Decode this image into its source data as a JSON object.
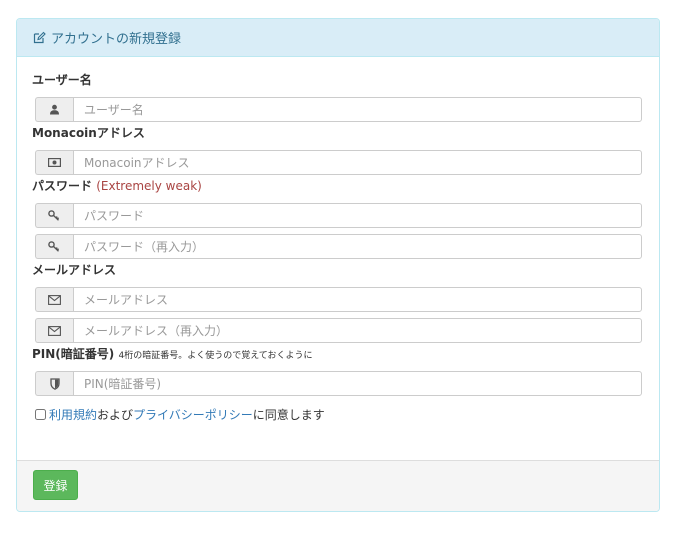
{
  "panel": {
    "title": "アカウントの新規登録",
    "icon": "edit-icon"
  },
  "username": {
    "label": "ユーザー名",
    "placeholder": "ユーザー名",
    "value": "",
    "icon": "user-icon"
  },
  "address": {
    "label": "Monacoinアドレス",
    "placeholder": "Monacoinアドレス",
    "value": "",
    "icon": "money-icon"
  },
  "password": {
    "label": "パスワード",
    "strength": "(Extremely weak)",
    "placeholder": "パスワード",
    "value": "",
    "confirm_placeholder": "パスワード（再入力）",
    "confirm_value": "",
    "icon": "key-icon"
  },
  "email": {
    "label": "メールアドレス",
    "placeholder": "メールアドレス",
    "value": "",
    "confirm_placeholder": "メールアドレス（再入力）",
    "confirm_value": "",
    "icon": "envelope-icon"
  },
  "pin": {
    "label": "PIN(暗証番号)",
    "hint": "4桁の暗証番号。よく使うので覚えておくように",
    "placeholder": "PIN(暗証番号)",
    "value": "",
    "icon": "shield-icon"
  },
  "agreement": {
    "checked": false,
    "terms_link": "利用規約",
    "and_text": "および",
    "privacy_link": "プライバシーポリシー",
    "suffix": "に同意します"
  },
  "footer": {
    "register_label": "登録"
  },
  "colors": {
    "heading_bg": "#d9edf7",
    "heading_text": "#31708f",
    "strength_text": "#a94442",
    "link": "#337ab7",
    "button": "#5cb85c"
  }
}
